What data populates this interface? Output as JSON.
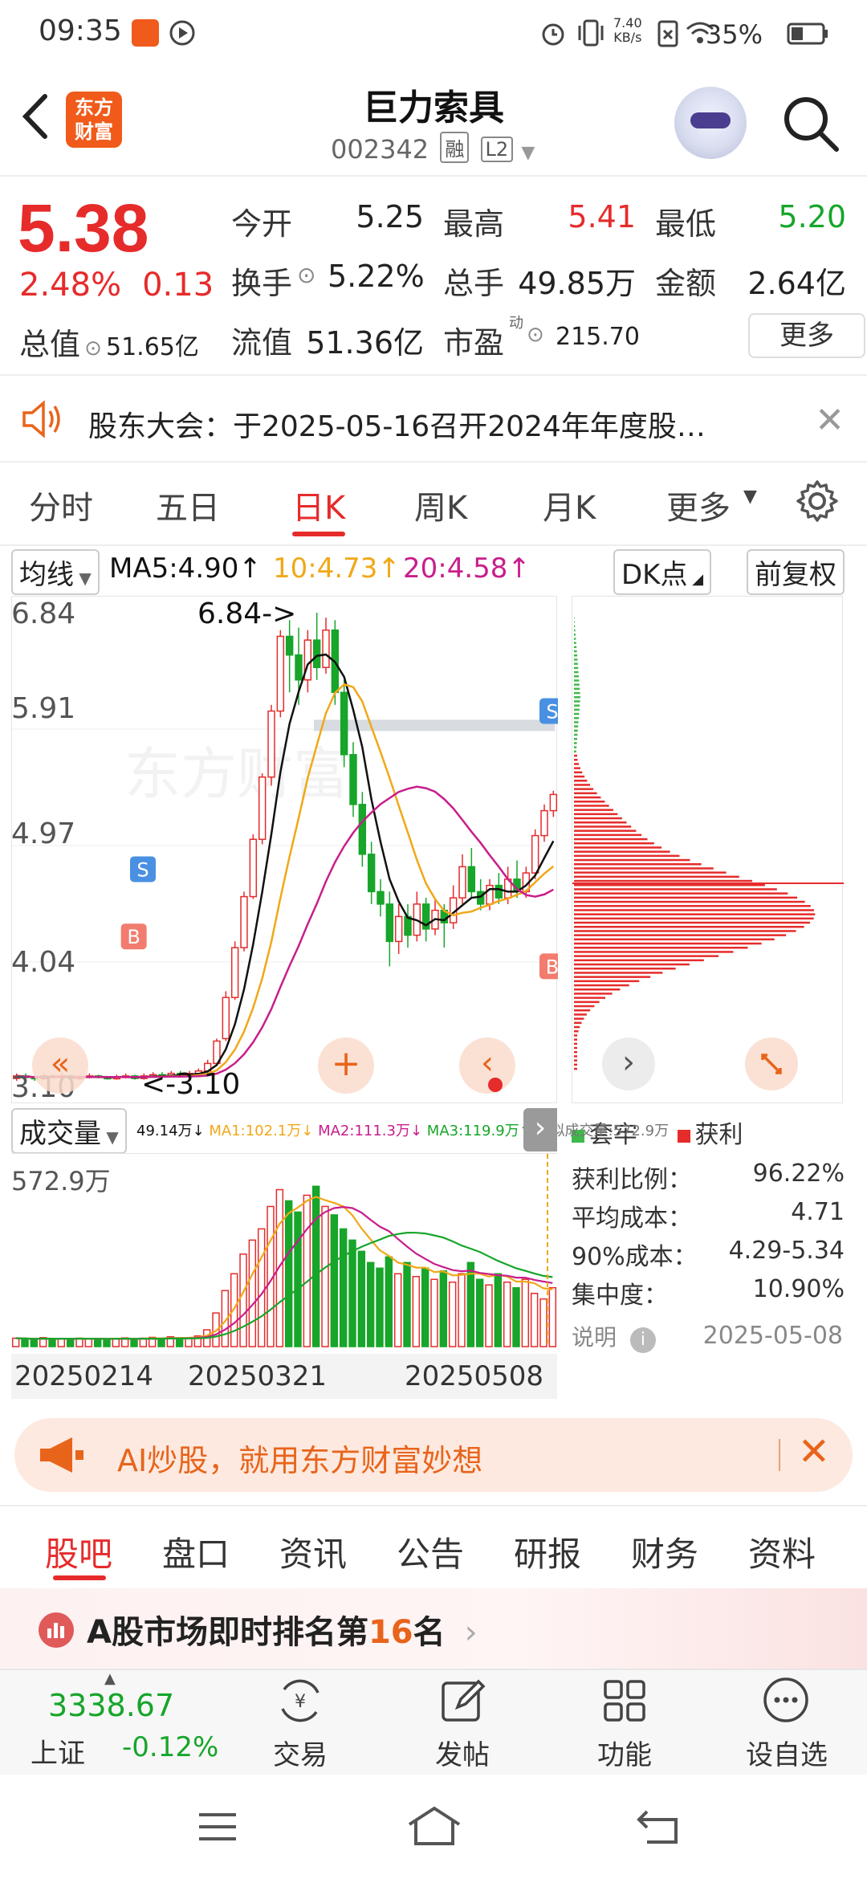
{
  "status_bar": {
    "time": "09:35",
    "net_speed": "7.40\nKB/s",
    "battery": "35%"
  },
  "header": {
    "logo_line1": "东方",
    "logo_line2": "财富",
    "name": "巨力索具",
    "code": "002342",
    "tag_margin": "融",
    "tag_level": "L2"
  },
  "quote": {
    "price": "5.38",
    "change_pct": "2.48%",
    "change_amt": "0.13",
    "open_label": "今开",
    "open": "5.25",
    "high_label": "最高",
    "high": "5.41",
    "low_label": "最低",
    "low": "5.20",
    "turnover_label": "换手",
    "turnover": "5.22%",
    "volume_label": "总手",
    "volume": "49.85万",
    "amount_label": "金额",
    "amount": "2.64亿",
    "mktcap_label": "总值",
    "mktcap": "51.65亿",
    "float_label": "流值",
    "float_cap": "51.36亿",
    "pe_label": "市盈",
    "pe_sup": "动",
    "pe": "215.70",
    "more": "更多",
    "colors": {
      "up": "#e62b2b",
      "down": "#17a52a"
    }
  },
  "notice": {
    "text": "股东大会：于2025-05-16召开2024年年度股…"
  },
  "chart_tabs": [
    "分时",
    "五日",
    "日K",
    "周K",
    "月K",
    "更多"
  ],
  "chart_active_tab": "日K",
  "ma_row": {
    "selector": "均线",
    "ma5": "MA5:4.90↑",
    "ma10": "10:4.73↑",
    "ma20": "20:4.58↑",
    "dk": "DK点",
    "adjust": "前复权"
  },
  "chart_data": [
    {
      "type": "candlestick",
      "title": "",
      "price_axis": [
        "6.84",
        "5.91",
        "4.97",
        "4.04",
        "3.10"
      ],
      "annotations": {
        "high_marker": "6.84->",
        "low_marker": "<-3.10"
      },
      "ylim": [
        3.1,
        6.84
      ],
      "candles": [
        [
          3.1,
          3.12,
          3.14,
          3.08
        ],
        [
          3.12,
          3.11,
          3.14,
          3.09
        ],
        [
          3.11,
          3.1,
          3.13,
          3.08
        ],
        [
          3.1,
          3.12,
          3.14,
          3.09
        ],
        [
          3.12,
          3.11,
          3.13,
          3.1
        ],
        [
          3.11,
          3.12,
          3.14,
          3.1
        ],
        [
          3.12,
          3.1,
          3.13,
          3.09
        ],
        [
          3.1,
          3.11,
          3.12,
          3.09
        ],
        [
          3.11,
          3.12,
          3.14,
          3.1
        ],
        [
          3.12,
          3.11,
          3.13,
          3.1
        ],
        [
          3.11,
          3.1,
          3.12,
          3.09
        ],
        [
          3.1,
          3.11,
          3.13,
          3.09
        ],
        [
          3.11,
          3.12,
          3.14,
          3.1
        ],
        [
          3.12,
          3.1,
          3.13,
          3.09
        ],
        [
          3.1,
          3.12,
          3.14,
          3.09
        ],
        [
          3.12,
          3.13,
          3.15,
          3.11
        ],
        [
          3.13,
          3.12,
          3.15,
          3.1
        ],
        [
          3.12,
          3.14,
          3.16,
          3.11
        ],
        [
          3.14,
          3.12,
          3.16,
          3.11
        ],
        [
          3.12,
          3.14,
          3.16,
          3.11
        ],
        [
          3.14,
          3.16,
          3.18,
          3.12
        ],
        [
          3.16,
          3.22,
          3.25,
          3.14
        ],
        [
          3.22,
          3.4,
          3.42,
          3.2
        ],
        [
          3.42,
          3.75,
          3.8,
          3.4
        ],
        [
          3.75,
          4.15,
          4.2,
          3.73
        ],
        [
          4.15,
          4.56,
          4.6,
          4.12
        ],
        [
          4.56,
          5.02,
          5.06,
          4.54
        ],
        [
          5.02,
          5.52,
          5.55,
          4.98
        ],
        [
          5.52,
          6.05,
          6.1,
          5.45
        ],
        [
          6.05,
          6.65,
          6.7,
          6.0
        ],
        [
          6.65,
          6.5,
          6.78,
          6.2
        ],
        [
          6.5,
          6.3,
          6.72,
          6.1
        ],
        [
          6.3,
          6.62,
          6.7,
          6.2
        ],
        [
          6.62,
          6.4,
          6.84,
          6.3
        ],
        [
          6.4,
          6.7,
          6.8,
          6.35
        ],
        [
          6.7,
          6.2,
          6.78,
          6.1
        ],
        [
          6.2,
          5.7,
          6.3,
          5.6
        ],
        [
          5.7,
          5.3,
          5.8,
          5.2
        ],
        [
          5.3,
          4.9,
          5.4,
          4.8
        ],
        [
          4.9,
          4.6,
          5.0,
          4.5
        ],
        [
          4.6,
          4.5,
          4.7,
          4.4
        ],
        [
          4.5,
          4.2,
          4.6,
          4.0
        ],
        [
          4.2,
          4.4,
          4.5,
          4.1
        ],
        [
          4.4,
          4.25,
          4.5,
          4.15
        ],
        [
          4.25,
          4.5,
          4.6,
          4.2
        ],
        [
          4.5,
          4.3,
          4.55,
          4.2
        ],
        [
          4.3,
          4.45,
          4.55,
          4.25
        ],
        [
          4.45,
          4.35,
          4.5,
          4.15
        ],
        [
          4.35,
          4.55,
          4.65,
          4.3
        ],
        [
          4.55,
          4.8,
          4.9,
          4.5
        ],
        [
          4.8,
          4.6,
          4.95,
          4.55
        ],
        [
          4.6,
          4.5,
          4.7,
          4.45
        ],
        [
          4.5,
          4.65,
          4.7,
          4.45
        ],
        [
          4.65,
          4.55,
          4.75,
          4.5
        ],
        [
          4.55,
          4.7,
          4.8,
          4.5
        ],
        [
          4.7,
          4.6,
          4.85,
          4.55
        ],
        [
          4.6,
          4.75,
          4.8,
          4.55
        ],
        [
          4.75,
          5.05,
          5.1,
          4.7
        ],
        [
          5.05,
          5.25,
          5.3,
          5.0
        ],
        [
          5.25,
          5.38,
          5.41,
          5.2
        ]
      ],
      "ma_colors": {
        "ma5": "#111111",
        "ma10": "#f0a818",
        "ma20": "#c81e8c"
      },
      "trade_marks": [
        "S",
        "B",
        "S",
        "B"
      ]
    },
    {
      "type": "bar",
      "title": "",
      "volume_selector": "成交量",
      "vol_value": "49.14万↓",
      "ma1": "MA1:102.1万↓",
      "ma2": "MA2:111.3万↓",
      "ma3": "MA3:119.9万↑",
      "virtual": "虚拟成交量:572.9万",
      "max_label": "572.9万",
      "x_ticks": [
        "20250214",
        "20250321",
        "20250508"
      ],
      "unit": "万",
      "values": [
        30,
        28,
        25,
        32,
        27,
        29,
        26,
        30,
        28,
        27,
        25,
        29,
        31,
        26,
        30,
        33,
        28,
        35,
        30,
        32,
        38,
        60,
        120,
        200,
        260,
        330,
        380,
        420,
        500,
        560,
        520,
        480,
        540,
        572,
        500,
        470,
        420,
        380,
        340,
        300,
        280,
        320,
        260,
        300,
        250,
        280,
        240,
        270,
        230,
        260,
        300,
        240,
        220,
        260,
        230,
        210,
        240,
        190,
        170,
        210
      ]
    }
  ],
  "distribution": {
    "legend_trapped": "套牢",
    "legend_profit": "获利",
    "rows": [
      {
        "label": "获利比例：",
        "value": "96.22%"
      },
      {
        "label": "平均成本：",
        "value": "4.71"
      },
      {
        "label": "90%成本：",
        "value": "4.29-5.34"
      },
      {
        "label": "集中度：",
        "value": "10.90%"
      }
    ],
    "explain": "说明",
    "date": "2025-05-08"
  },
  "ai_banner": {
    "text": "AI炒股，就用东方财富妙想"
  },
  "bottom_tabs": [
    "股吧",
    "盘口",
    "资讯",
    "公告",
    "研报",
    "财务",
    "资料"
  ],
  "rank": {
    "prefix": "A股市场即时排名第",
    "rank": "16",
    "suffix": "名"
  },
  "bottom_nav": {
    "index_value": "3338.67",
    "index_name": "上证",
    "index_change": "-0.12%",
    "items": [
      "交易",
      "发帖",
      "功能",
      "设自选"
    ]
  }
}
